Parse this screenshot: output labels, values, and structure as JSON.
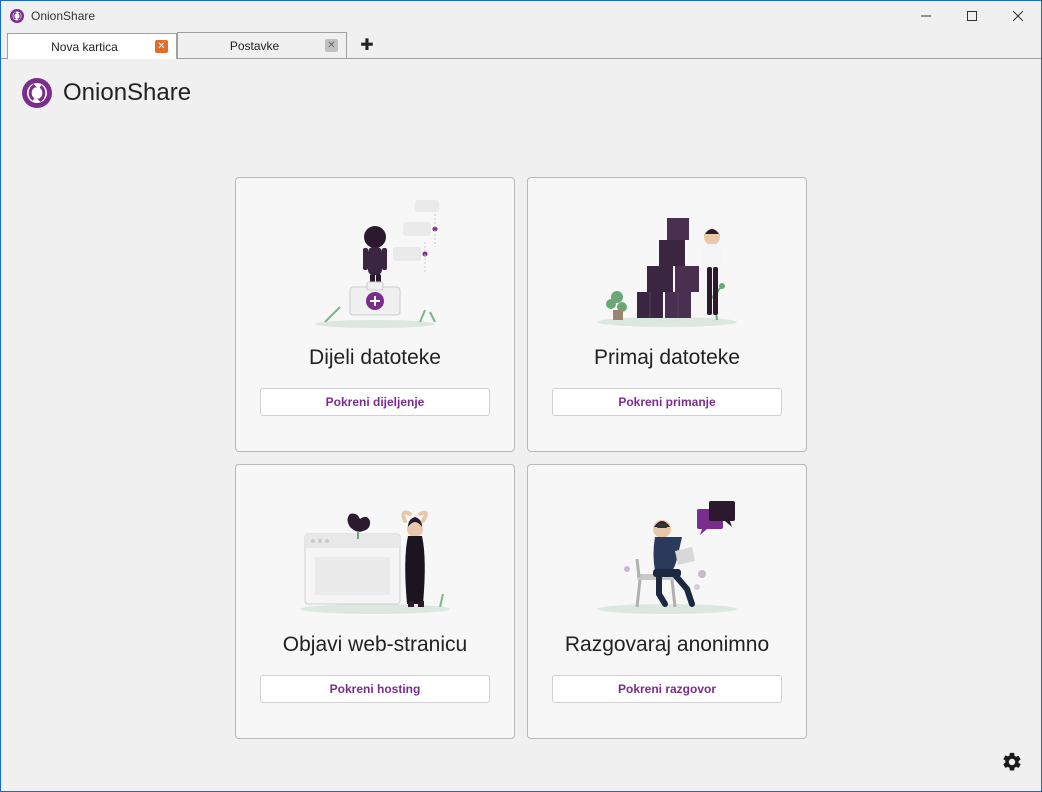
{
  "window": {
    "title": "OnionShare"
  },
  "tabs": [
    {
      "label": "Nova kartica",
      "active": true
    },
    {
      "label": "Postavke",
      "active": false
    }
  ],
  "brand": {
    "name": "OnionShare"
  },
  "cards": [
    {
      "title": "Dijeli datoteke",
      "button": "Pokreni dijeljenje"
    },
    {
      "title": "Primaj datoteke",
      "button": "Pokreni primanje"
    },
    {
      "title": "Objavi web-stranicu",
      "button": "Pokreni hosting"
    },
    {
      "title": "Razgovaraj anonimno",
      "button": "Pokreni razgovor"
    }
  ]
}
